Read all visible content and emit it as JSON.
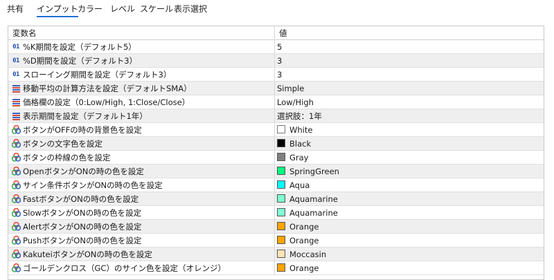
{
  "tabs": [
    {
      "label": "共有",
      "active": false
    },
    {
      "label": "インプット",
      "active": true
    },
    {
      "label": "カラー",
      "active": false
    },
    {
      "label": "レベル",
      "active": false
    },
    {
      "label": "スケール",
      "active": false
    },
    {
      "label": "表示選択",
      "active": false
    }
  ],
  "table": {
    "columns": [
      "変数名",
      "値"
    ],
    "rows": [
      {
        "icon": "int-icon",
        "name": "%K期間を設定（デフォルト5）",
        "value": "5"
      },
      {
        "icon": "int-icon",
        "name": "%D期間を設定（デフォルト3）",
        "value": "3"
      },
      {
        "icon": "int-icon",
        "name": "スローイング期間を設定（デフォルト3）",
        "value": "3"
      },
      {
        "icon": "enum-icon",
        "name": "移動平均の計算方法を設定（デフォルトSMA）",
        "value": "Simple"
      },
      {
        "icon": "enum-icon",
        "name": "価格欄の設定（0:Low/High, 1:Close/Close）",
        "value": "Low/High"
      },
      {
        "icon": "enum-icon",
        "name": "表示期間を設定（デフォルト1年）",
        "value": "選択肢：1年"
      },
      {
        "icon": "color-icon",
        "name": "ボタンがOFFの時の背景色を設定",
        "value": "White",
        "swatch": "#ffffff"
      },
      {
        "icon": "color-icon",
        "name": "ボタンの文字色を設定",
        "value": "Black",
        "swatch": "#000000"
      },
      {
        "icon": "color-icon",
        "name": "ボタンの枠線の色を設定",
        "value": "Gray",
        "swatch": "#808080"
      },
      {
        "icon": "color-icon",
        "name": "OpenボタンがONの時の色を設定",
        "value": "SpringGreen",
        "swatch": "#00ff7f"
      },
      {
        "icon": "color-icon",
        "name": "サイン条件ボタンがONの時の色を設定",
        "value": "Aqua",
        "swatch": "#00ffff"
      },
      {
        "icon": "color-icon",
        "name": "FastボタンがONの時の色を設定",
        "value": "Aquamarine",
        "swatch": "#7fffd4"
      },
      {
        "icon": "color-icon",
        "name": "SlowボタンがONの時の色を設定",
        "value": "Aquamarine",
        "swatch": "#7fffd4"
      },
      {
        "icon": "color-icon",
        "name": "AlertボタンがONの時の色を設定",
        "value": "Orange",
        "swatch": "#ffa500"
      },
      {
        "icon": "color-icon",
        "name": "PushボタンがONの時の色を設定",
        "value": "Orange",
        "swatch": "#ffa500"
      },
      {
        "icon": "color-icon",
        "name": "KakuteiボタンがONの時の色を設定",
        "value": "Moccasin",
        "swatch": "#ffe4b5"
      },
      {
        "icon": "color-icon",
        "name": "ゴールデンクロス（GC）のサイン色を設定（オレンジ）",
        "value": "Orange",
        "swatch": "#ffa500"
      }
    ]
  }
}
